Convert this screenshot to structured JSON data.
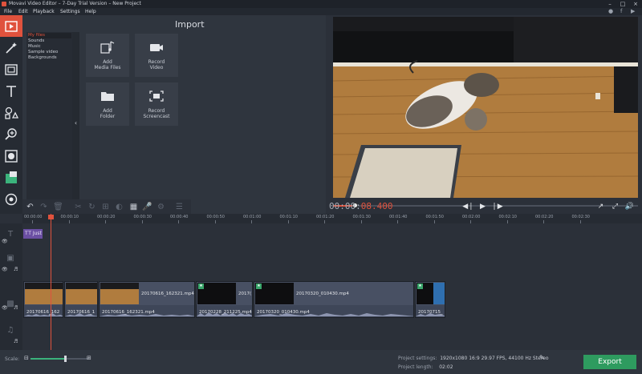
{
  "window": {
    "title": "Movavi Video Editor – 7-Day Trial Version – New Project"
  },
  "menu": [
    "File",
    "Edit",
    "Playback",
    "Settings",
    "Help"
  ],
  "left_tools": [
    "import",
    "filters",
    "transitions",
    "titles",
    "stickers",
    "zoom",
    "highlight",
    "pip",
    "stabilization"
  ],
  "import": {
    "title": "Import",
    "categories": [
      "My files",
      "Sounds",
      "Music",
      "Sample video",
      "Backgrounds"
    ],
    "selected_category": "My files",
    "tiles": [
      {
        "line1": "Add",
        "line2": "Media Files"
      },
      {
        "line1": "Record",
        "line2": "Video"
      },
      {
        "line1": "Add",
        "line2": "Folder"
      },
      {
        "line1": "Record",
        "line2": "Screencast"
      }
    ]
  },
  "player": {
    "timecode_main": "00:00:",
    "timecode_accent": "08.400",
    "progress": 0.07
  },
  "ruler": [
    "00:00:00",
    "00:00:10",
    "00:00:20",
    "00:00:30",
    "00:00:40",
    "00:00:50",
    "00:01:00",
    "00:01:10",
    "00:01:20",
    "00:01:30",
    "00:01:40",
    "00:01:50",
    "00:02:00",
    "00:02:10",
    "00:02:20",
    "00:02:30"
  ],
  "title_clip": "Just",
  "video_clips": [
    {
      "name": "",
      "audio": "20170616_162"
    },
    {
      "name": "",
      "audio": "20170616_1"
    },
    {
      "name": "20170616_162321.mp4",
      "audio": "20170616_162321.mp4"
    },
    {
      "name": "2017(",
      "audio": "20170228_211225.mp4"
    },
    {
      "name": "20170320_010430.mp4",
      "audio": "20170320_010430.mp4"
    },
    {
      "name": "",
      "audio": "20170715_"
    }
  ],
  "bottom": {
    "scale_label": "Scale:",
    "scale_value": 0.6,
    "settings_label": "Project settings:",
    "settings_value": "1920x1080 16:9 29.97 FPS, 44100 Hz Stereo",
    "length_label": "Project length:",
    "length_value": "02:02",
    "export_label": "Export"
  },
  "colors": {
    "accent": "#e0523d",
    "export": "#2e9b5f",
    "title_clip": "#6b4fa3"
  }
}
